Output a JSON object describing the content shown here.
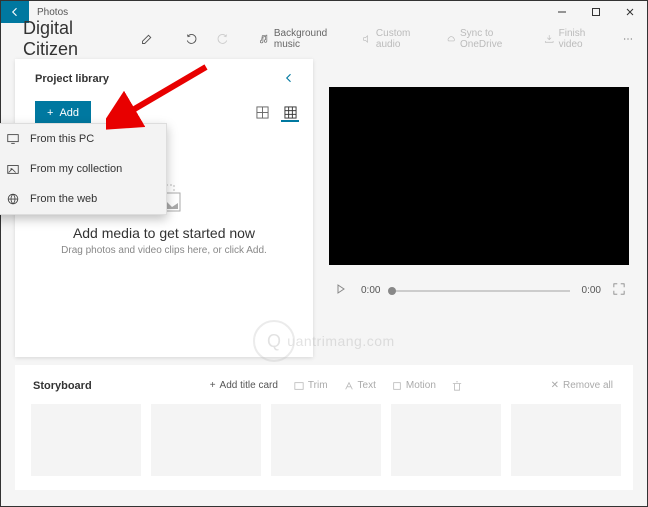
{
  "window": {
    "title": "Photos"
  },
  "project": {
    "name": "Digital Citizen"
  },
  "toolbar": {
    "bg_music": "Background music",
    "custom_audio": "Custom audio",
    "sync": "Sync to OneDrive",
    "finish": "Finish video"
  },
  "library": {
    "title": "Project library",
    "add_label": "Add",
    "empty_title": "Add media to get started now",
    "empty_sub": "Drag photos and video clips here, or click Add.",
    "dropdown": {
      "pc": "From this PC",
      "collection": "From my collection",
      "web": "From the web"
    }
  },
  "playback": {
    "current": "0:00",
    "total": "0:00"
  },
  "storyboard": {
    "title": "Storyboard",
    "add_title_card": "Add title card",
    "trim": "Trim",
    "text": "Text",
    "motion": "Motion",
    "remove_all": "Remove all"
  },
  "watermark": {
    "text": "uantrimang"
  }
}
